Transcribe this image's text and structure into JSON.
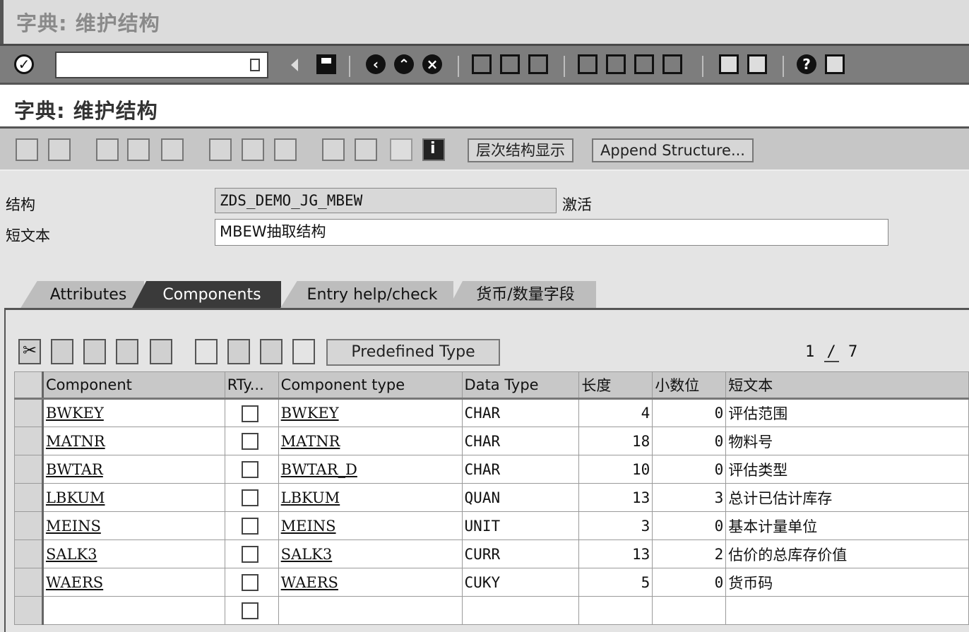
{
  "window": {
    "title": "字典: 维护结构"
  },
  "system_toolbar": {
    "command_field_value": ""
  },
  "app": {
    "title": "字典: 维护结构"
  },
  "app_toolbar": {
    "hierarchy_button": "层次结构显示",
    "append_structure_button": "Append Structure..."
  },
  "header": {
    "structure_label": "结构",
    "structure_value": "ZDS_DEMO_JG_MBEW",
    "status": "激活",
    "short_text_label": "短文本",
    "short_text_value": "MBEW抽取结构"
  },
  "tabs": [
    {
      "label": "Attributes",
      "active": false
    },
    {
      "label": "Components",
      "active": true
    },
    {
      "label": "Entry help/check",
      "active": false
    },
    {
      "label": "货币/数量字段",
      "active": false
    }
  ],
  "table_toolbar": {
    "predefined_type_button": "Predefined Type",
    "page_current": "1",
    "page_sep": "/",
    "page_total": "7"
  },
  "table": {
    "columns": [
      "Component",
      "RTy...",
      "Component type",
      "Data Type",
      "长度",
      "小数位",
      "短文本"
    ],
    "rows": [
      {
        "component": "BWKEY",
        "component_type": "BWKEY",
        "data_type": "CHAR",
        "length": "4",
        "decimals": "0",
        "short_text": "评估范围"
      },
      {
        "component": "MATNR",
        "component_type": "MATNR",
        "data_type": "CHAR",
        "length": "18",
        "decimals": "0",
        "short_text": "物料号"
      },
      {
        "component": "BWTAR",
        "component_type": "BWTAR_D",
        "data_type": "CHAR",
        "length": "10",
        "decimals": "0",
        "short_text": "评估类型"
      },
      {
        "component": "LBKUM",
        "component_type": "LBKUM",
        "data_type": "QUAN",
        "length": "13",
        "decimals": "3",
        "short_text": "总计已估计库存"
      },
      {
        "component": "MEINS",
        "component_type": "MEINS",
        "data_type": "UNIT",
        "length": "3",
        "decimals": "0",
        "short_text": "基本计量单位"
      },
      {
        "component": "SALK3",
        "component_type": "SALK3",
        "data_type": "CURR",
        "length": "13",
        "decimals": "2",
        "short_text": "估价的总库存价值"
      },
      {
        "component": "WAERS",
        "component_type": "WAERS",
        "data_type": "CUKY",
        "length": "5",
        "decimals": "0",
        "short_text": "货币码"
      }
    ]
  }
}
